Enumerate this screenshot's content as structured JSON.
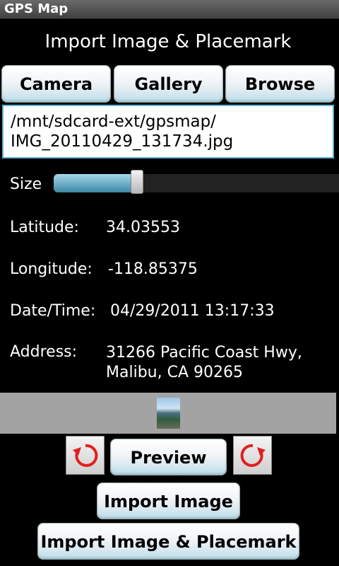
{
  "app": {
    "title": "GPS Map"
  },
  "screen": {
    "heading": "Import Image & Placemark"
  },
  "source_buttons": {
    "camera": "Camera",
    "gallery": "Gallery",
    "browse": "Browse"
  },
  "file": {
    "path_line1": "/mnt/sdcard-ext/gpsmap/",
    "path_line2": "IMG_20110429_131734.jpg"
  },
  "size": {
    "label": "Size",
    "level": 0.29
  },
  "details": {
    "latitude_label": "Latitude:",
    "latitude": "34.03553",
    "longitude_label": "Longitude:",
    "longitude": "-118.85375",
    "datetime_label": "Date/Time:",
    "datetime": "04/29/2011 13:17:33",
    "address_label": "Address:",
    "address_line1": "31266 Pacific Coast Hwy,",
    "address_line2": "Malibu, CA 90265"
  },
  "actions": {
    "preview": "Preview",
    "import_image": "Import Image",
    "import_image_placemark": "Import Image & Placemark",
    "rotate_left_icon": "rotate-left-icon",
    "rotate_right_icon": "rotate-right-icon"
  },
  "colors": {
    "accent_blue": "#5fb4d2",
    "rotate_red": "#e02020"
  }
}
